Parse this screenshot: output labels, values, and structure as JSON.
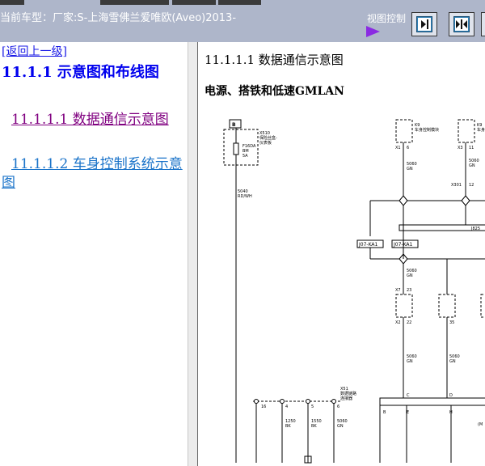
{
  "toolbar": {
    "car_model": "当前车型：厂家:S-上海雪佛兰爱唯欧(Aveo)2013-",
    "view_control_label": "视图控制"
  },
  "nav": {
    "back": "[返回上一级]",
    "items": [
      {
        "label": "11.1.1 示意图和布线图"
      },
      {
        "label": "11.1.1.1 数据通信示意图"
      },
      {
        "label": "11.1.1.2 车身控制系统示意图"
      }
    ]
  },
  "document": {
    "title": "11.1.1.1 数据通信示意图",
    "subtitle": "电源、搭铁和低速GMLAN"
  },
  "diagram": {
    "fuse_box_label": "B",
    "fuse_label": "F16DA\nBM\n5A",
    "module_label_tl": "X510\n保险丝盒-\n仪表板",
    "module_label_t1": "K9\n车身控制模块",
    "module_label_t2": "K9\n车身控制",
    "pin_x1": "X1",
    "pin_x1_num": "6",
    "pin_x3": "X3",
    "pin_x3_num": "11",
    "wire_5060_gn": "5060\nGN",
    "wire_5060_gn_2": "5060\nGN",
    "wire_5040_rdwh": "5040\nRD/WH",
    "x301_label": "X301",
    "x301_num": "12",
    "j825": "J825",
    "conn_left": "J07-KA1",
    "conn_right": "J07-KA1",
    "wire_5060_gn_3": "5060\nGN",
    "pin_x7": "X7",
    "pin_x7_num": "23",
    "pin_x2": "X2",
    "pin_x2_num": "22",
    "pin_35": "35",
    "wire_5060_gn_4": "5060\nGN",
    "wire_5060_gn_5": "5060\nGN",
    "bottom_conn": "X51\n数据链路\n连接器",
    "pin_16": "16",
    "pin_4": "4",
    "pin_5": "5",
    "pin_6": "6",
    "pin_c": "C",
    "pin_d": "D",
    "pin_b": "B",
    "pin_e": "E",
    "pin_h": "H",
    "wire_1250_bk": "1250\nBK",
    "wire_1550_bk": "1550\nBK",
    "wire_5060_gn_6": "5060\nGN",
    "lbl_m": "(M"
  }
}
